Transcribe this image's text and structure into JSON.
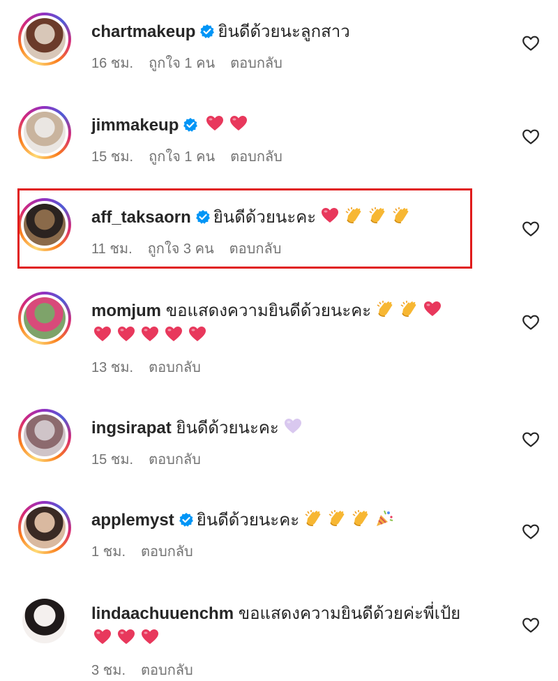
{
  "comments": [
    {
      "username": "chartmakeup",
      "verified": true,
      "text": "ยินดีด้วยนะลูกสาว",
      "emoji": [],
      "emoji2": [],
      "time": "16 ชม.",
      "likes": "ถูกใจ 1 คน",
      "reply": "ตอบกลับ",
      "avatar_colors": [
        "#d8c7b8",
        "#6b3b2a"
      ]
    },
    {
      "username": "jimmakeup",
      "verified": true,
      "text": "",
      "emoji": [
        "heart",
        "heart"
      ],
      "emoji2": [],
      "time": "15 ชม.",
      "likes": "ถูกใจ 1 คน",
      "reply": "ตอบกลับ",
      "avatar_colors": [
        "#eae6e2",
        "#c9b49e"
      ]
    },
    {
      "username": "aff_taksaorn",
      "verified": true,
      "text": "ยินดีด้วยนะคะ",
      "emoji": [
        "heart",
        "clap",
        "clap",
        "clap"
      ],
      "emoji2": [],
      "time": "11 ชม.",
      "likes": "ถูกใจ 3 คน",
      "reply": "ตอบกลับ",
      "highlighted": true,
      "avatar_colors": [
        "#8a6a4a",
        "#2b2320"
      ]
    },
    {
      "username": "momjum",
      "verified": false,
      "text": "ขอแสดงความยินดีด้วยนะคะ",
      "emoji": [
        "clap",
        "clap",
        "heart"
      ],
      "emoji2": [
        "heart",
        "heart",
        "heart",
        "heart",
        "heart"
      ],
      "time": "13 ชม.",
      "likes": "",
      "reply": "ตอบกลับ",
      "avatar_colors": [
        "#7ea36a",
        "#d84a7a"
      ]
    },
    {
      "username": "ingsirapat",
      "verified": false,
      "text": "ยินดีด้วยนะคะ",
      "emoji": [
        "lilac-heart"
      ],
      "emoji2": [],
      "time": "15 ชม.",
      "likes": "",
      "reply": "ตอบกลับ",
      "avatar_colors": [
        "#cfc4c8",
        "#8c6a6e"
      ]
    },
    {
      "username": "applemyst",
      "verified": true,
      "text": "ยินดีด้วยนะคะ",
      "emoji": [
        "clap",
        "clap",
        "clap",
        "party-popper"
      ],
      "emoji2": [],
      "time": "1 ชม.",
      "likes": "",
      "reply": "ตอบกลับ",
      "avatar_colors": [
        "#d9b9a0",
        "#3a2a24"
      ]
    },
    {
      "username": "lindaachuuenchm",
      "verified": false,
      "text": "ขอแสดงความยินดีด้วยค่ะพี่เป้ย",
      "emoji": [],
      "emoji2": [
        "heart",
        "heart",
        "heart"
      ],
      "time": "3 ชม.",
      "likes": "",
      "reply": "ตอบกลับ",
      "avatar_colors": [
        "#f4f0ee",
        "#1f1a1a"
      ]
    }
  ],
  "icons": {
    "like": "heart-outline-icon",
    "verified": "verified-badge-icon"
  },
  "colors": {
    "verified": "#0095f6",
    "highlight_border": "#e01b1b",
    "meta_text": "#737373",
    "heart": "#e8385c",
    "clap": "#f7b733"
  }
}
